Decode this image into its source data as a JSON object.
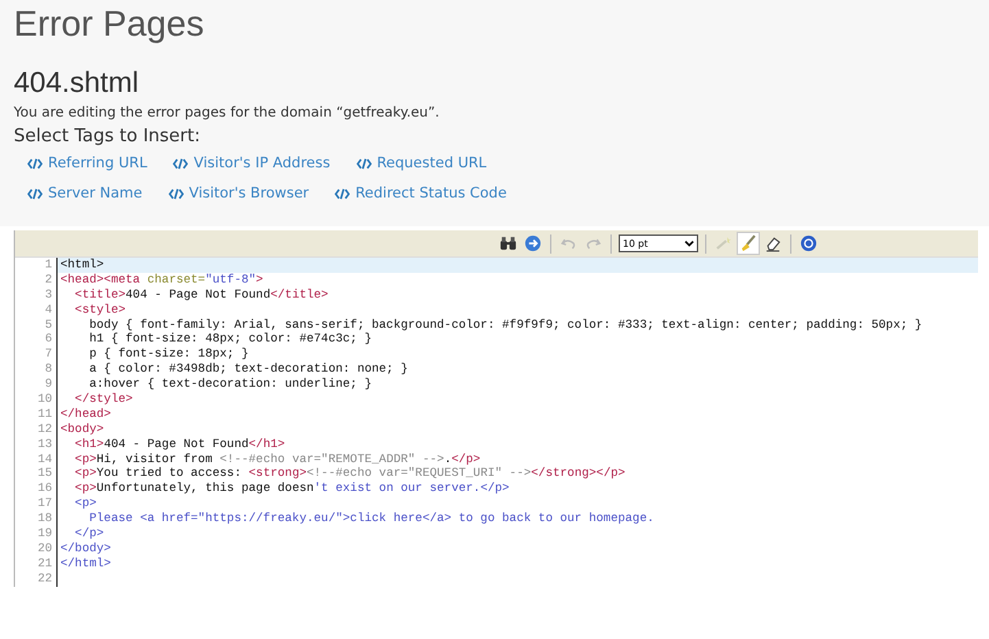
{
  "page_title": "Error Pages",
  "file_name": "404.shtml",
  "description": "You are editing the error pages for the domain “getfreaky.eu”.",
  "tags_heading": "Select Tags to Insert:",
  "tag_links": [
    [
      {
        "label": "Referring URL"
      },
      {
        "label": "Visitor's IP Address"
      },
      {
        "label": "Requested URL"
      }
    ],
    [
      {
        "label": "Server Name"
      },
      {
        "label": "Visitor's Browser"
      },
      {
        "label": "Redirect Status Code"
      }
    ]
  ],
  "toolbar": {
    "font_size": "10 pt"
  },
  "editor": {
    "lines": [
      {
        "number": "1",
        "selected": true,
        "segments": [
          {
            "kind": "text",
            "text": "<html>"
          }
        ]
      },
      {
        "number": "2",
        "selected": false,
        "segments": [
          {
            "kind": "tag",
            "text": "<head><meta "
          },
          {
            "kind": "attr",
            "text": "charset="
          },
          {
            "kind": "string",
            "text": "\"utf-8\""
          },
          {
            "kind": "tag",
            "text": ">"
          }
        ]
      },
      {
        "number": "3",
        "selected": false,
        "segments": [
          {
            "kind": "tag",
            "text": "  <title>"
          },
          {
            "kind": "text",
            "text": "404 - Page Not Found"
          },
          {
            "kind": "tag",
            "text": "</title>"
          }
        ]
      },
      {
        "number": "4",
        "selected": false,
        "segments": [
          {
            "kind": "tag",
            "text": "  <style>"
          }
        ]
      },
      {
        "number": "5",
        "selected": false,
        "segments": [
          {
            "kind": "text",
            "text": "    body { font-family: Arial, sans-serif; background-color: #f9f9f9; color: #333; text-align: center; padding: 50px; }"
          }
        ]
      },
      {
        "number": "6",
        "selected": false,
        "segments": [
          {
            "kind": "text",
            "text": "    h1 { font-size: 48px; color: #e74c3c; }"
          }
        ]
      },
      {
        "number": "7",
        "selected": false,
        "segments": [
          {
            "kind": "text",
            "text": "    p { font-size: 18px; }"
          }
        ]
      },
      {
        "number": "8",
        "selected": false,
        "segments": [
          {
            "kind": "text",
            "text": "    a { color: #3498db; text-decoration: none; }"
          }
        ]
      },
      {
        "number": "9",
        "selected": false,
        "segments": [
          {
            "kind": "text",
            "text": "    a:hover { text-decoration: underline; }"
          }
        ]
      },
      {
        "number": "10",
        "selected": false,
        "segments": [
          {
            "kind": "tag",
            "text": "  </style>"
          }
        ]
      },
      {
        "number": "11",
        "selected": false,
        "segments": [
          {
            "kind": "tag",
            "text": "</head>"
          }
        ]
      },
      {
        "number": "12",
        "selected": false,
        "segments": [
          {
            "kind": "tag",
            "text": "<body>"
          }
        ]
      },
      {
        "number": "13",
        "selected": false,
        "segments": [
          {
            "kind": "tag",
            "text": "  <h1>"
          },
          {
            "kind": "text",
            "text": "404 - Page Not Found"
          },
          {
            "kind": "tag",
            "text": "</h1>"
          }
        ]
      },
      {
        "number": "14",
        "selected": false,
        "segments": [
          {
            "kind": "tag",
            "text": "  <p>"
          },
          {
            "kind": "text",
            "text": "Hi, visitor from "
          },
          {
            "kind": "comment",
            "text": "<!--#echo var=\"REMOTE_ADDR\" -->"
          },
          {
            "kind": "text",
            "text": "."
          },
          {
            "kind": "tag",
            "text": "</p>"
          }
        ]
      },
      {
        "number": "15",
        "selected": false,
        "segments": [
          {
            "kind": "tag",
            "text": "  <p>"
          },
          {
            "kind": "text",
            "text": "You tried to access: "
          },
          {
            "kind": "tag",
            "text": "<strong>"
          },
          {
            "kind": "comment",
            "text": "<!--#echo var=\"REQUEST_URI\" -->"
          },
          {
            "kind": "tag",
            "text": "</strong></p>"
          }
        ]
      },
      {
        "number": "16",
        "selected": false,
        "segments": [
          {
            "kind": "tag",
            "text": "  <p>"
          },
          {
            "kind": "text",
            "text": "Unfortunately, this page doesn"
          },
          {
            "kind": "string",
            "text": "'t exist on our server.</p>"
          }
        ]
      },
      {
        "number": "17",
        "selected": false,
        "segments": [
          {
            "kind": "string",
            "text": "  <p>"
          }
        ]
      },
      {
        "number": "18",
        "selected": false,
        "segments": [
          {
            "kind": "string",
            "text": "    Please <a href=\"https://freaky.eu/\">click here</a> to go back to our homepage."
          }
        ]
      },
      {
        "number": "19",
        "selected": false,
        "segments": [
          {
            "kind": "string",
            "text": "  </p>"
          }
        ]
      },
      {
        "number": "20",
        "selected": false,
        "segments": [
          {
            "kind": "string",
            "text": "</body>"
          }
        ]
      },
      {
        "number": "21",
        "selected": false,
        "segments": [
          {
            "kind": "string",
            "text": "</html>"
          }
        ]
      },
      {
        "number": "22",
        "selected": false
      }
    ]
  }
}
